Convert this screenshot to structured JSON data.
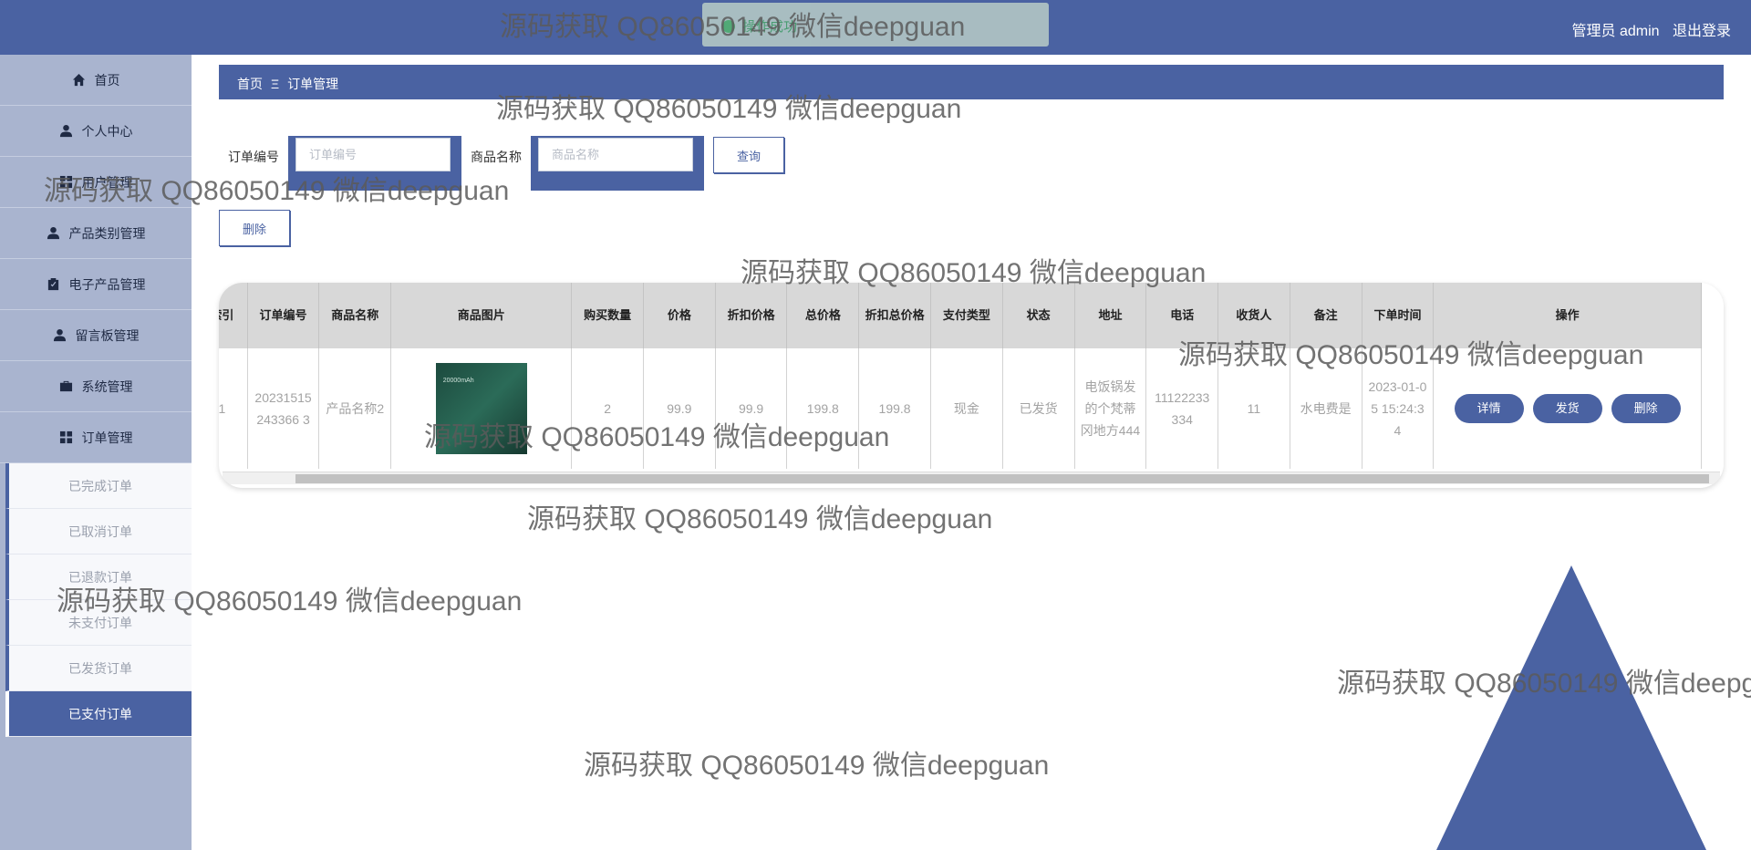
{
  "header": {
    "user_label": "管理员 admin",
    "logout": "退出登录",
    "toast": "操作成功"
  },
  "sidebar": {
    "items": [
      {
        "label": "首页",
        "icon": "home-icon"
      },
      {
        "label": "个人中心",
        "icon": "person-icon"
      },
      {
        "label": "用户管理",
        "icon": "grid-icon"
      },
      {
        "label": "产品类别管理",
        "icon": "person-icon"
      },
      {
        "label": "电子产品管理",
        "icon": "clipboard-icon"
      },
      {
        "label": "留言板管理",
        "icon": "person-icon"
      },
      {
        "label": "系统管理",
        "icon": "briefcase-icon"
      },
      {
        "label": "订单管理",
        "icon": "grid-icon"
      }
    ],
    "subitems": [
      "已完成订单",
      "已取消订单",
      "已退款订单",
      "未支付订单",
      "已发货订单",
      "已支付订单"
    ],
    "active_sub": "已支付订单"
  },
  "breadcrumb": {
    "home": "首页",
    "sep": "Ξ",
    "current": "订单管理"
  },
  "search": {
    "order_no_label": "订单编号",
    "order_no_placeholder": "订单编号",
    "product_name_label": "商品名称",
    "product_name_placeholder": "商品名称",
    "query_button": "查询"
  },
  "delete_button": "删除",
  "table": {
    "columns": [
      "索引",
      "订单编号",
      "商品名称",
      "商品图片",
      "购买数量",
      "价格",
      "折扣价格",
      "总价格",
      "折扣总价格",
      "支付类型",
      "状态",
      "地址",
      "电话",
      "收货人",
      "备注",
      "下单时间",
      "操作"
    ],
    "rows": [
      {
        "index": "1",
        "order_no": "20231515243366 3",
        "product_name": "产品名称2",
        "image_caption": "20000mAh",
        "quantity": "2",
        "price": "99.9",
        "discount_price": "99.9",
        "total": "199.8",
        "discount_total": "199.8",
        "pay_type": "现金",
        "status": "已发货",
        "address": "电饭锅发的个梵蒂冈地方444",
        "phone": "11122233334",
        "receiver": "11",
        "remark": "水电费是",
        "order_time": "2023-01-05 15:24:34",
        "actions": [
          "详情",
          "发货",
          "删除"
        ]
      }
    ]
  },
  "watermark": "源码获取 QQ86050149 微信deepguan",
  "colors": {
    "primary": "#4a62a2",
    "sidebar": "#a9b4cf"
  }
}
